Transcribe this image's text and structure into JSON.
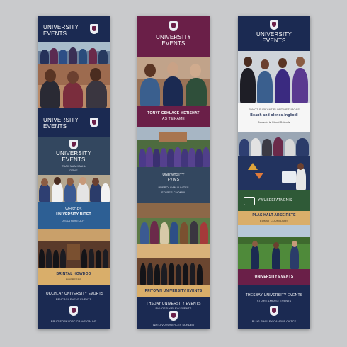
{
  "strip1": {
    "header_title": "UNIVERSITY EVENTS",
    "mid_title": "UNIVERSITY EVENTS",
    "slate_title": "UNIVERSITY EVENTS",
    "slate_sub1": "TUAK NUAKISAKL",
    "slate_sub2": "DRNE",
    "blue_line1": "WHSOES",
    "blue_line2": "UNIVERSITY BIDET",
    "blue_line3": "ASSA NONTUDY",
    "sand_line1": "BRINTAL HOWDOD",
    "sand_line2": "PLISPESSE",
    "footer_line1": "TUKCHLAY UNIVERSITY EVORTS",
    "footer_line2": "RRVCAGL EVENT EVENTS",
    "footer_line3": "BRUG FORKLOPC CRAVE GAUHT"
  },
  "strip2": {
    "header_title": "UNIVERSITY EVENTS",
    "plum_line1": "TONYF CSHLACE METISHAT",
    "plum_line2": "AS T&IKAME",
    "slate_line1": "UNEWTSITY",
    "slate_line2": "FVIMS",
    "slate_line3": "BNEROLGAN LUNITES",
    "slate_line4": "STARES CNOMUL",
    "sand_line1": "PFITOWN UNIVERSITY EVENTS",
    "footer_line1": "THSDAY UNIVERSITY EVENTS",
    "footer_line2": "RHVOSSLY PLEW EVENTS",
    "footer_line3": "WATD VUROSERCES SCRDED"
  },
  "strip3": {
    "header_title": "UNIVERSITY EVENTS",
    "white_line1": "PANOT SURKANT PLONT METUROAS",
    "white_line2": "Boanh and olenss-lngliodl",
    "white_line3": "Bnoeolo le Stoud Pakoole",
    "green_line1": "YWUSEEFATNENIS",
    "sand_line1": "PLAS HALT ARSE RSTE",
    "sand_line2": "EONST COUNTLORS",
    "plum_line1": "UNIVERSITY EVENTS",
    "footer_line1": "THESBAY UNIVERSITY EVENTS",
    "footer_line2": "STUIRE LMFAST EVENTS",
    "footer_line3": "BLUG SIMKLEY CAMPUS ONTCE"
  }
}
